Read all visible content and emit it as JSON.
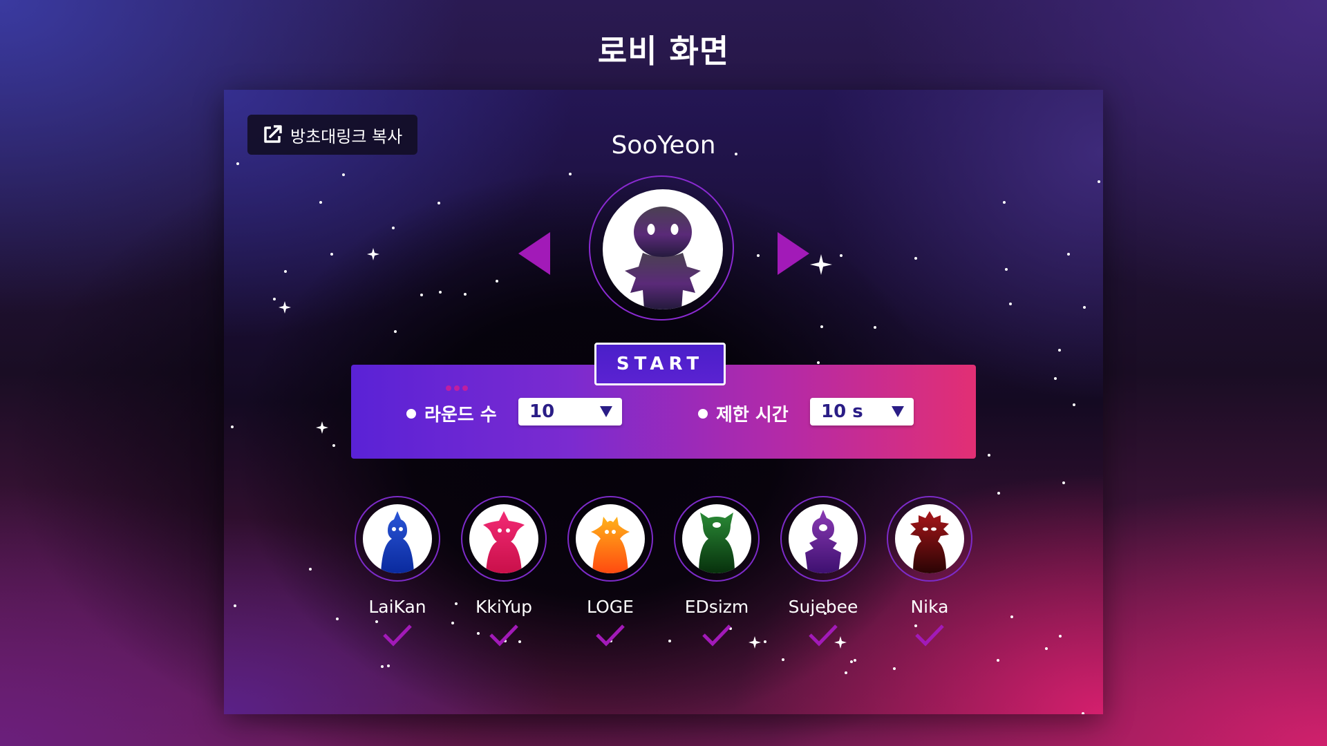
{
  "page": {
    "title": "로비 화면"
  },
  "toolbar": {
    "share_label": "방초대링크 복사"
  },
  "host": {
    "name": "SooYeon"
  },
  "start_label": "START",
  "settings": {
    "rounds": {
      "label": "라운드 수",
      "value": "10"
    },
    "time_limit": {
      "label": "제한 시간",
      "value": "10 s"
    }
  },
  "players": [
    {
      "name": "LaiKan",
      "color": "#1d3fc4",
      "ready": true
    },
    {
      "name": "KkiYup",
      "color": "#e0185a",
      "ready": true
    },
    {
      "name": "LOGE",
      "color": "#ff7a14",
      "ready": true
    },
    {
      "name": "EDsizm",
      "color": "#155c1c",
      "ready": true
    },
    {
      "name": "Sujebee",
      "color": "#5a1c8c",
      "ready": true
    },
    {
      "name": "Nika",
      "color": "#7a0d0d",
      "ready": true
    }
  ],
  "colors": {
    "accent": "#a21ab8",
    "panel_start": "#5a22d6",
    "panel_end": "#e22f74",
    "check": "#a21ab8"
  }
}
